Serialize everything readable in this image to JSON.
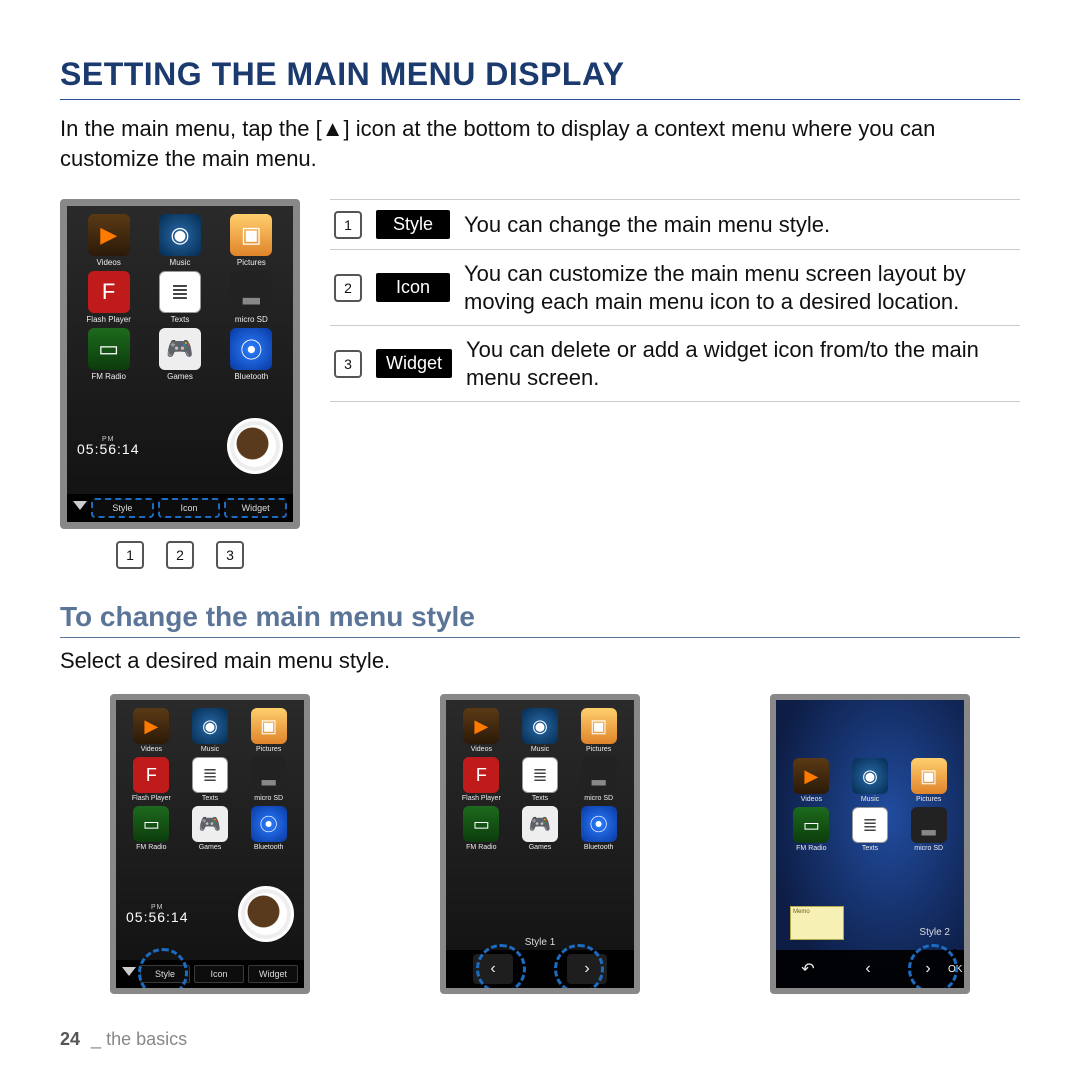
{
  "heading": "SETTING THE MAIN MENU DISPLAY",
  "intro": "In the main menu, tap the [▲] icon at the bottom to display a context menu where you can customize the main menu.",
  "apps": {
    "videos": "Videos",
    "music": "Music",
    "pictures": "Pictures",
    "flash": "Flash Player",
    "texts": "Texts",
    "sd": "micro SD",
    "radio": "FM Radio",
    "games": "Games",
    "bt": "Bluetooth"
  },
  "clock": {
    "ampm": "PM",
    "time": "05:56:14"
  },
  "bottombar": {
    "style": "Style",
    "icon": "Icon",
    "widget": "Widget"
  },
  "callouts": {
    "n1": "1",
    "n2": "2",
    "n3": "3"
  },
  "desc": [
    {
      "n": "1",
      "chip": "Style",
      "text": "You can change the main menu style."
    },
    {
      "n": "2",
      "chip": "Icon",
      "text": "You can customize the main menu screen layout by moving each main menu icon to a desired location."
    },
    {
      "n": "3",
      "chip": "Widget",
      "text": "You can delete or add a widget icon from/to the main menu screen."
    }
  ],
  "subheading": "To change the main menu style",
  "subtext": "Select a desired main menu style.",
  "style_labels": {
    "s1": "Style 1",
    "s2": "Style 2"
  },
  "nav": {
    "back": "↶",
    "prev": "‹",
    "next": "›",
    "ok": "OK"
  },
  "memo": "Memo",
  "footer": {
    "page": "24",
    "sep": "_",
    "section": "the basics"
  }
}
